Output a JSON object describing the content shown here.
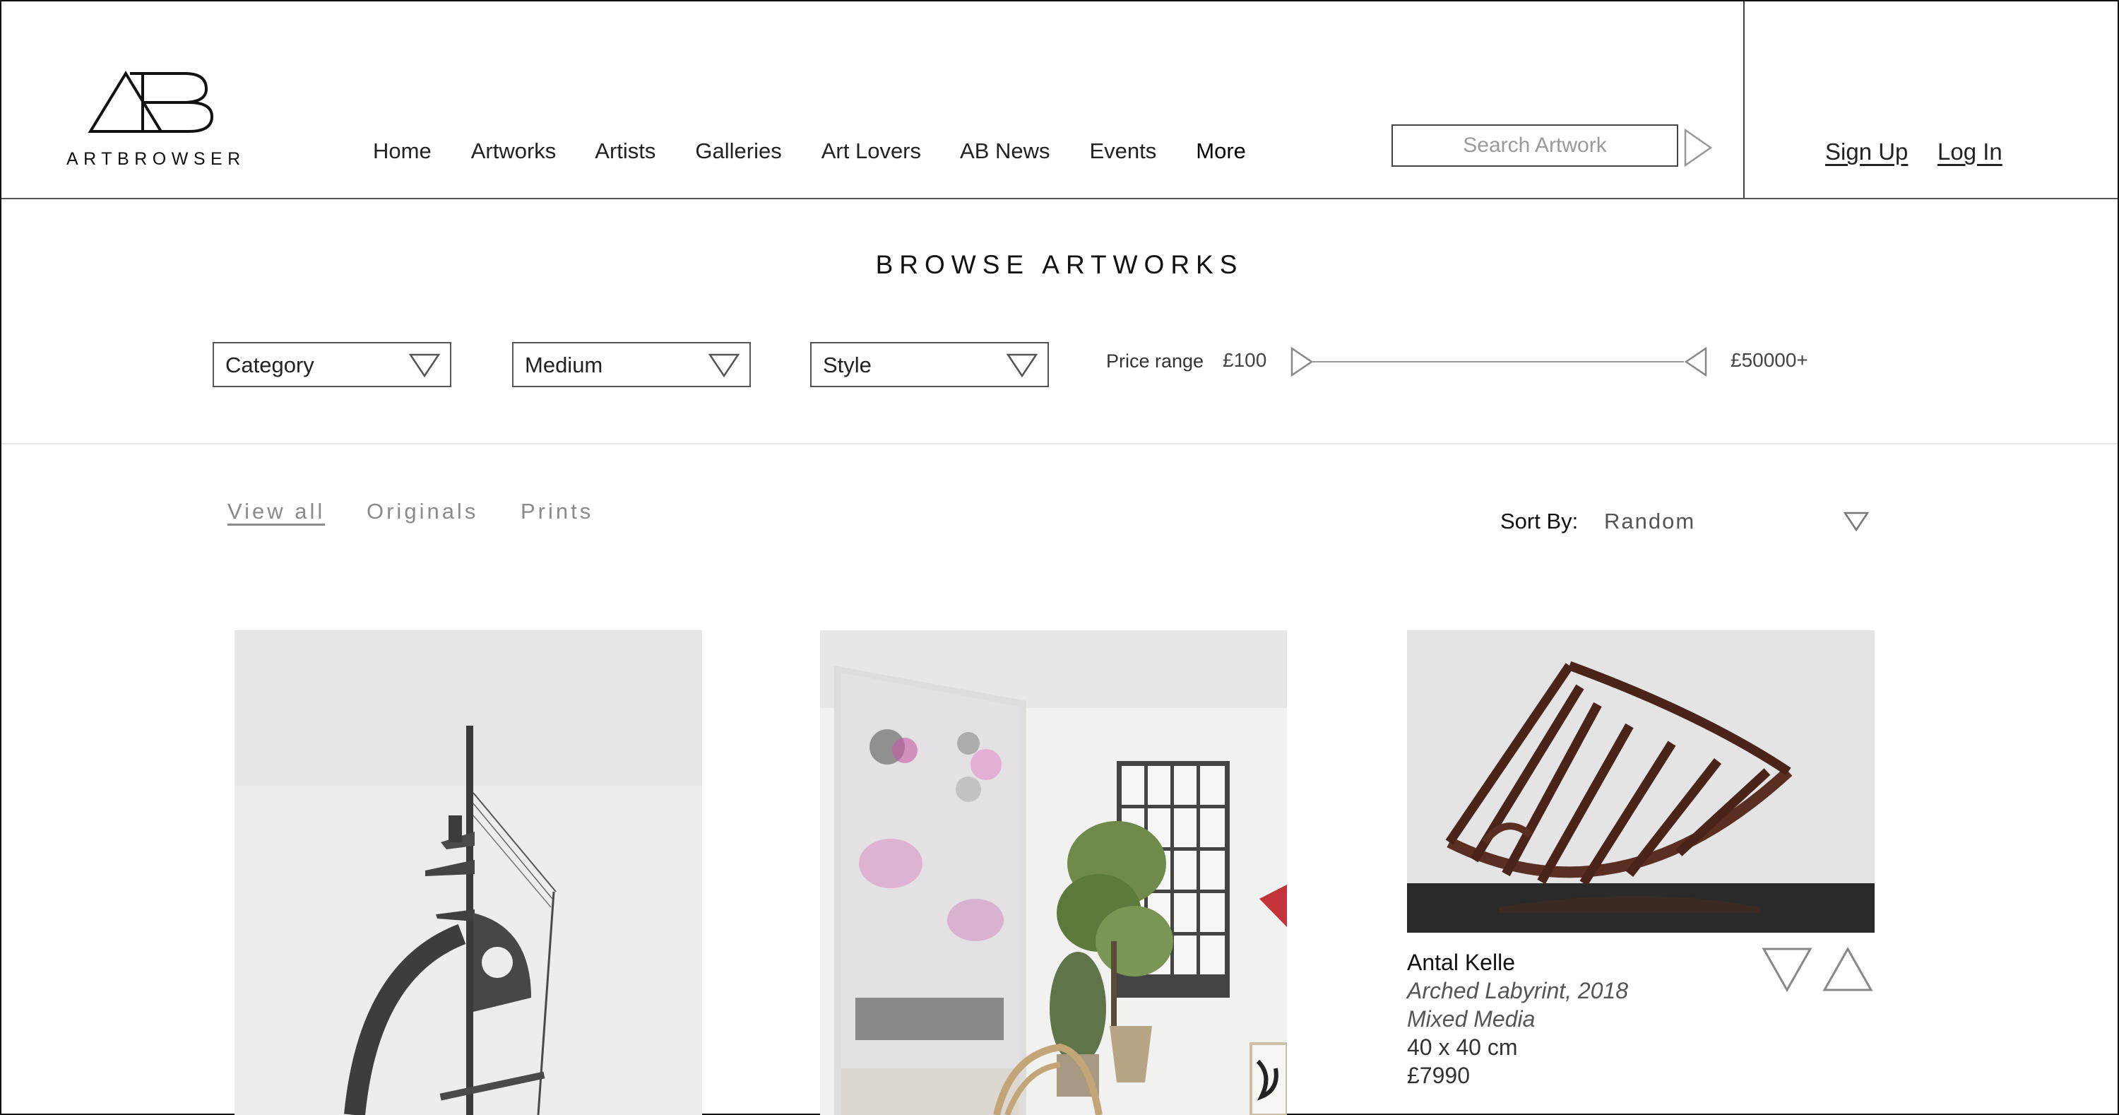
{
  "brand": {
    "name": "ARTBROWSER",
    "logo_glyphs": "AB"
  },
  "nav": {
    "items": [
      {
        "label": "Home"
      },
      {
        "label": "Artworks"
      },
      {
        "label": "Artists"
      },
      {
        "label": "Galleries"
      },
      {
        "label": "Art Lovers"
      },
      {
        "label": "AB News"
      },
      {
        "label": "Events"
      },
      {
        "label": "More"
      }
    ]
  },
  "search": {
    "placeholder": "Search Artwork",
    "submit_icon": "triangle-right-icon"
  },
  "auth": {
    "signup": "Sign Up",
    "login": "Log In"
  },
  "page": {
    "title": "BROWSE ARTWORKS"
  },
  "filters": {
    "category": "Category",
    "medium": "Medium",
    "style": "Style",
    "price_label": "Price range",
    "price_min": "£100",
    "price_max": "£50000+"
  },
  "tabs": [
    {
      "label": "View all",
      "active": true
    },
    {
      "label": "Originals",
      "active": false
    },
    {
      "label": "Prints",
      "active": false
    }
  ],
  "sort": {
    "label": "Sort By:",
    "value": "Random"
  },
  "artworks": [
    {
      "image": "abstract metal sculpture"
    },
    {
      "image": "abstract painting in studio"
    },
    {
      "image": "arched wooden sculpture",
      "artist": "Antal Kelle",
      "title": "Arched Labyrint, 2018",
      "medium": "Mixed Media",
      "size": "40 x 40 cm",
      "price": "£7990"
    }
  ],
  "colors": {
    "text": "#111111",
    "muted": "#8a8a8a",
    "border": "#555555",
    "icon": "#888888"
  }
}
